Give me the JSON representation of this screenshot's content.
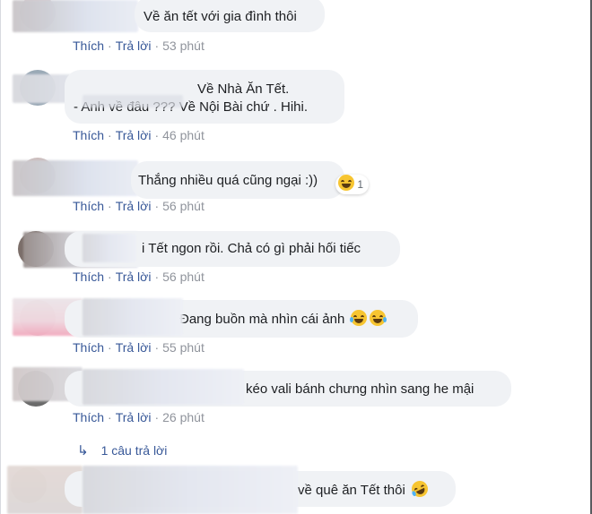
{
  "comments": [
    {
      "text": "Về ăn tết với gia đình thôi",
      "like": "Thích",
      "reply": "Trả lời",
      "time": "53 phút"
    },
    {
      "text": "Về Nhà Ăn Tết.",
      "text2": "- Anh về đâu ??? Về Nội Bài chứ . Hihi.",
      "like": "Thích",
      "reply": "Trả lời",
      "time": "46 phút"
    },
    {
      "text": "Thắng nhiều quá cũng ngại :))",
      "reaction_count": "1",
      "reaction_icon": "laughing-emoji-icon",
      "like": "Thích",
      "reply": "Trả lời",
      "time": "56 phút"
    },
    {
      "text": "i Tết ngon rồi. Chả có gì phải hối tiếc",
      "like": "Thích",
      "reply": "Trả lời",
      "time": "56 phút"
    },
    {
      "text": "Đang buồn mà nhìn cái ảnh",
      "emoji": "tears-of-joy-emoji-icon",
      "like": "Thích",
      "reply": "Trả lời",
      "time": "55 phút"
    },
    {
      "text": "kéo vali bánh chưng nhìn sang he mậi",
      "like": "Thích",
      "reply": "Trả lời",
      "time": "26 phút",
      "replies_link": "1 câu trả lời"
    },
    {
      "text": "về quê ăn Tết thôi",
      "emoji": "rolling-laughing-emoji-icon"
    }
  ],
  "separator": "·"
}
